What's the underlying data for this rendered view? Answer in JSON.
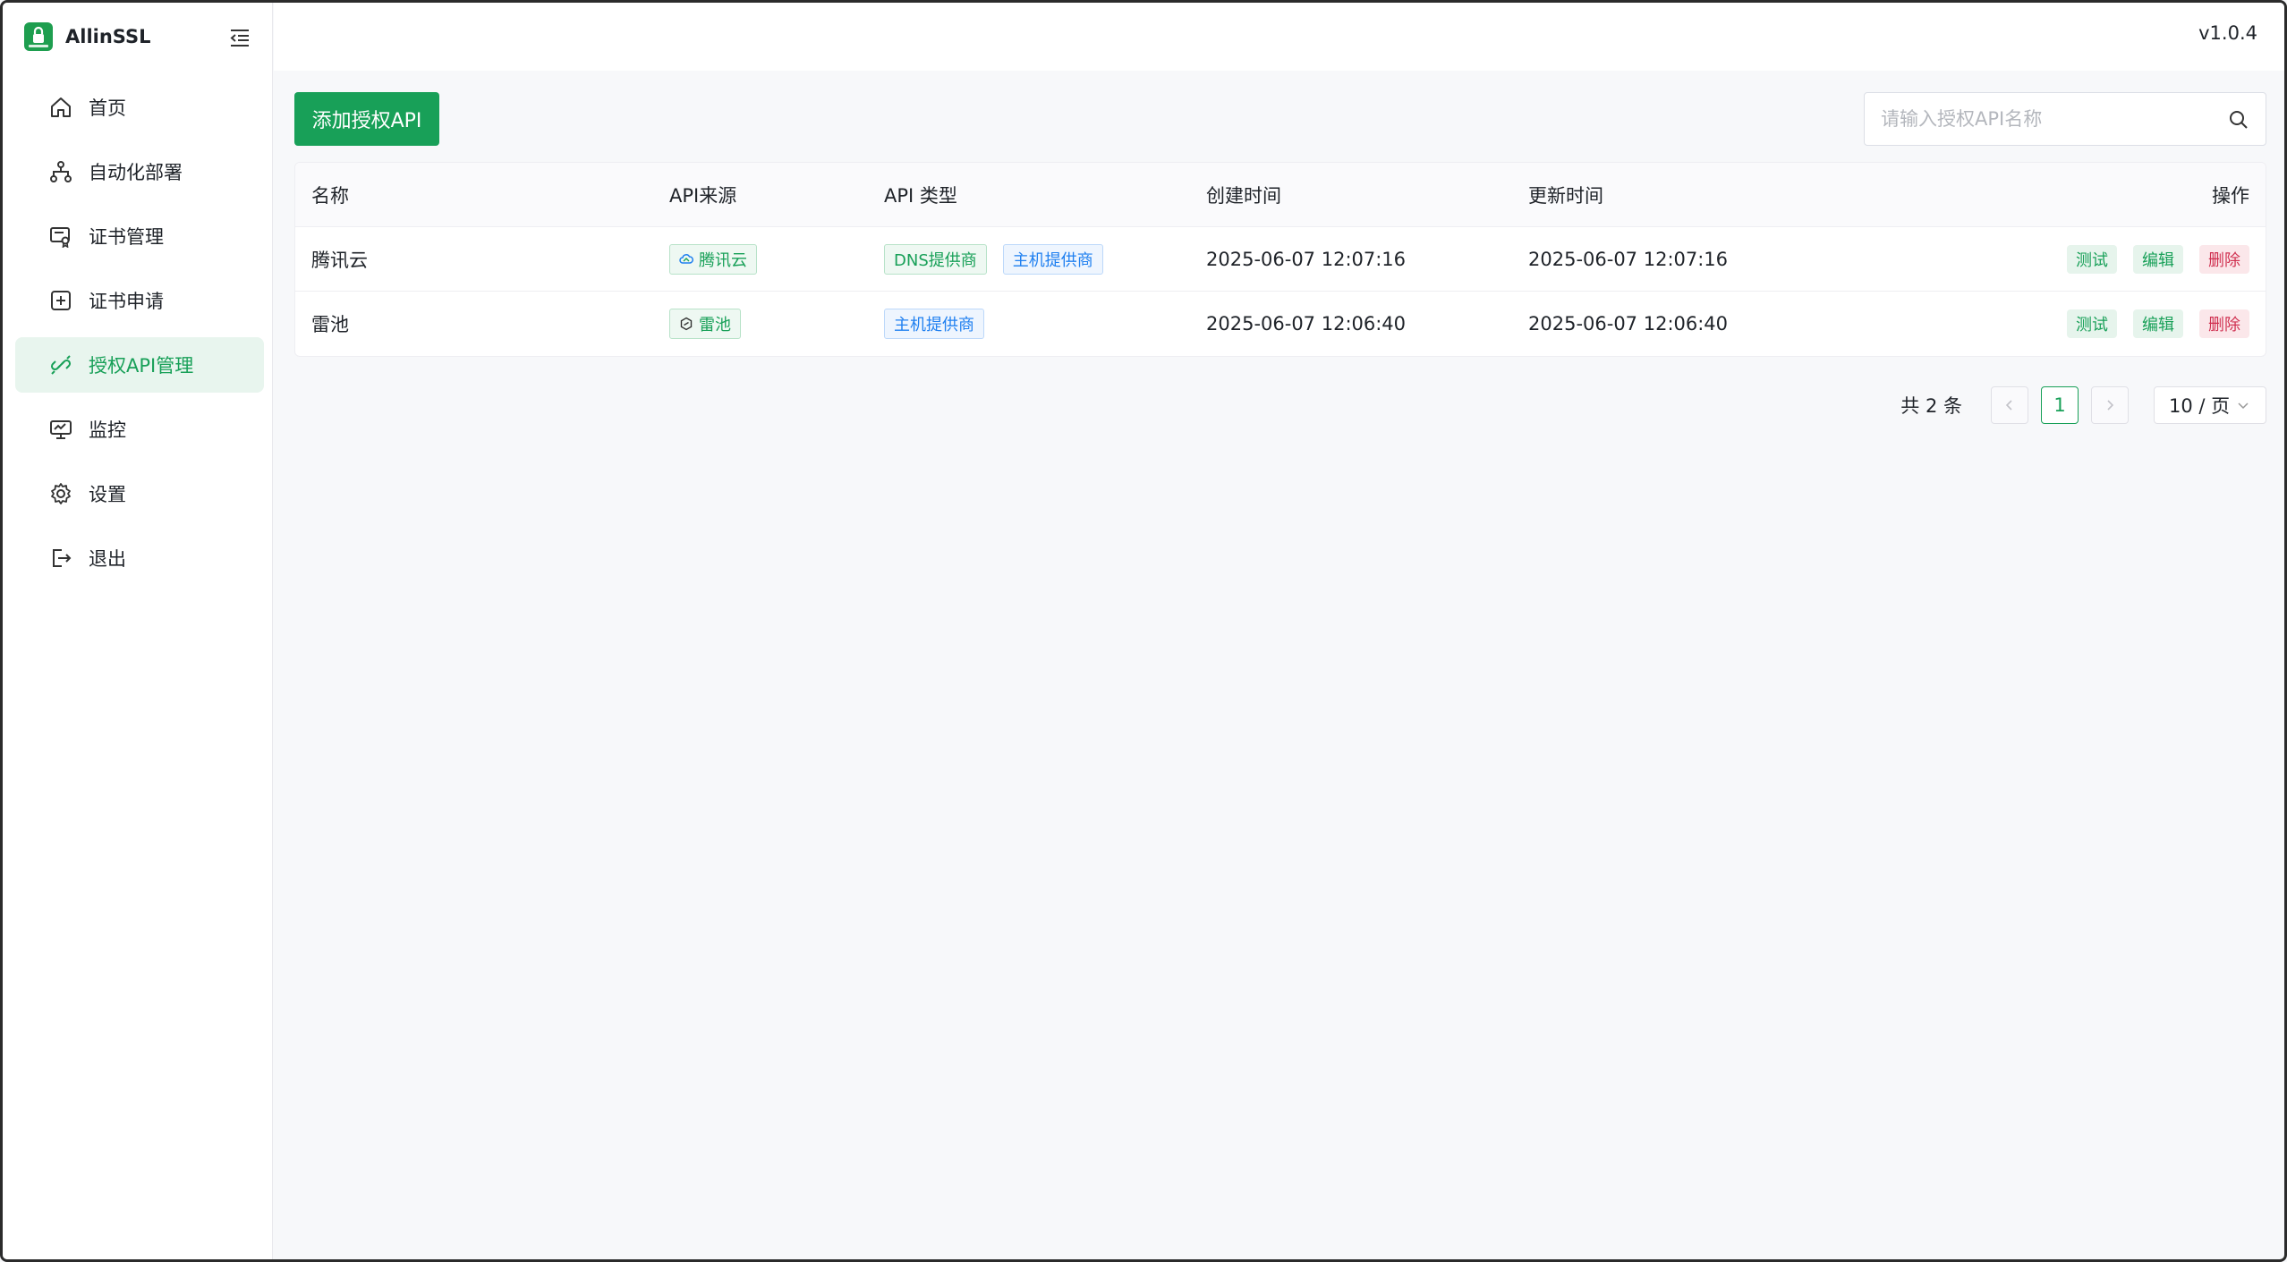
{
  "app": {
    "name": "AllinSSL",
    "version": "v1.0.4"
  },
  "sidebar": {
    "items": [
      {
        "label": "首页",
        "icon": "home-icon"
      },
      {
        "label": "自动化部署",
        "icon": "workflow-icon"
      },
      {
        "label": "证书管理",
        "icon": "certificate-icon"
      },
      {
        "label": "证书申请",
        "icon": "plus-square-icon"
      },
      {
        "label": "授权API管理",
        "icon": "api-link-icon",
        "active": true
      },
      {
        "label": "监控",
        "icon": "monitor-icon"
      },
      {
        "label": "设置",
        "icon": "gear-icon"
      },
      {
        "label": "退出",
        "icon": "logout-icon"
      }
    ]
  },
  "toolbar": {
    "add_label": "添加授权API"
  },
  "search": {
    "placeholder": "请输入授权API名称",
    "value": ""
  },
  "table": {
    "headers": {
      "name": "名称",
      "source": "API来源",
      "type": "API 类型",
      "created": "创建时间",
      "updated": "更新时间",
      "ops": "操作"
    },
    "rows": [
      {
        "name": "腾讯云",
        "source": "腾讯云",
        "source_icon": "cloud-icon",
        "types": [
          "DNS提供商",
          "主机提供商"
        ],
        "created": "2025-06-07 12:07:16",
        "updated": "2025-06-07 12:07:16"
      },
      {
        "name": "雷池",
        "source": "雷池",
        "source_icon": "hexagon-icon",
        "types": [
          "主机提供商"
        ],
        "created": "2025-06-07 12:06:40",
        "updated": "2025-06-07 12:06:40"
      }
    ],
    "ops": {
      "test": "测试",
      "edit": "编辑",
      "delete": "删除"
    }
  },
  "pagination": {
    "total_label": "共 2 条",
    "current_page": "1",
    "page_size": "10 / 页"
  },
  "colors": {
    "primary": "#18a058",
    "danger": "#d03050",
    "info": "#2080f0"
  }
}
